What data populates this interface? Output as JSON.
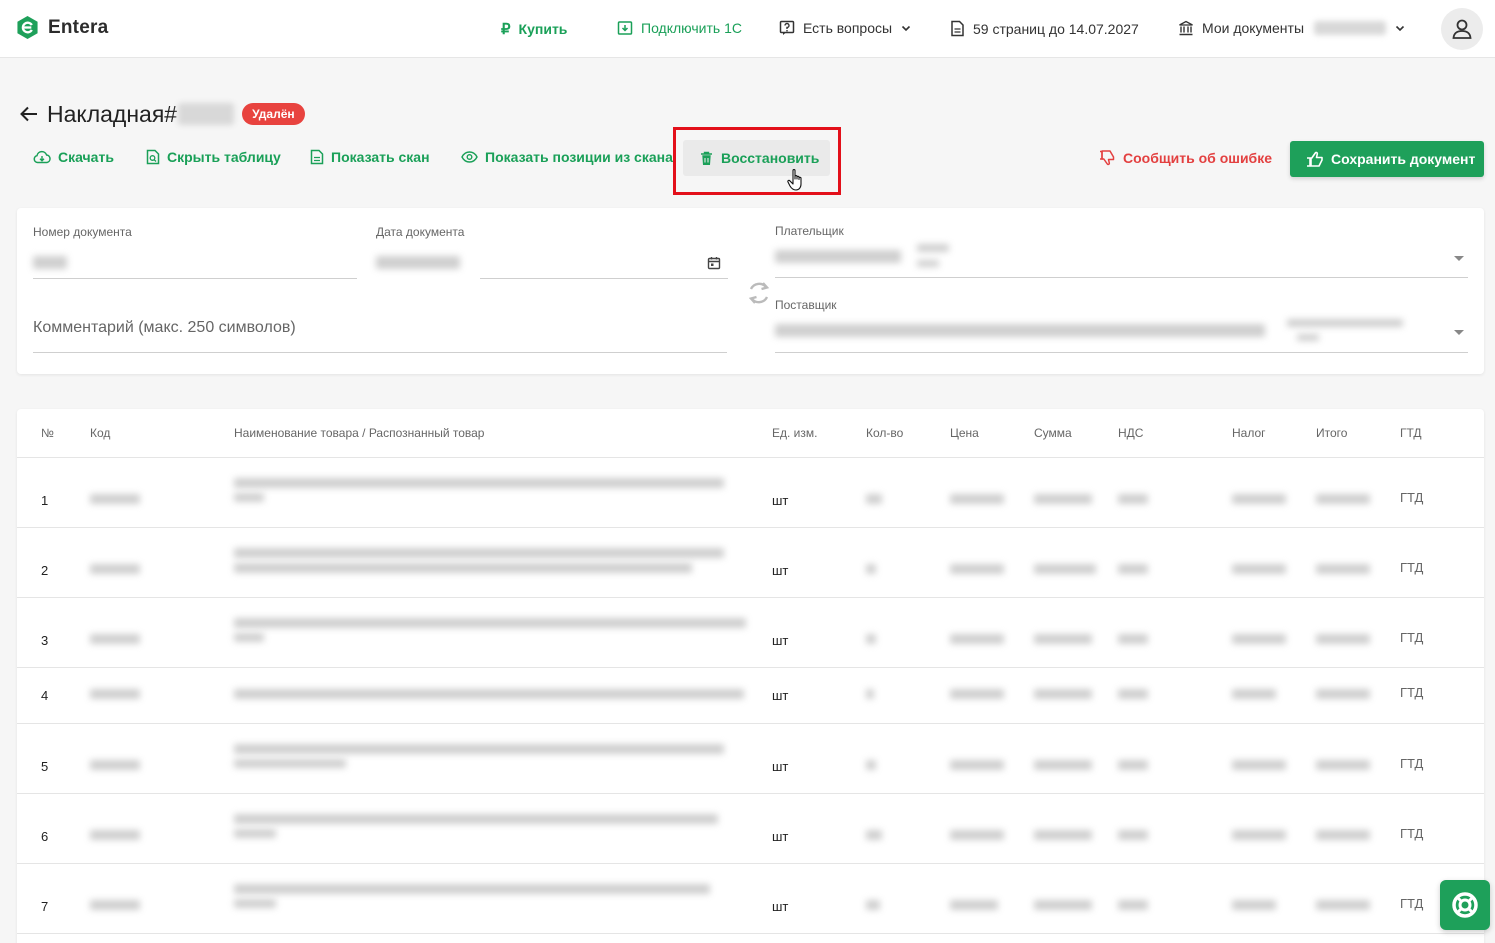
{
  "header": {
    "logo_text": "Entera",
    "buy_label": "Купить",
    "connect_label": "Подключить 1С",
    "questions_label": "Есть вопросы",
    "pages_label": "59 страниц до 14.07.2027",
    "documents_label": "Мои документы"
  },
  "title": {
    "text": "Накладная#",
    "status_badge": "Удалён"
  },
  "actions": {
    "download": "Скачать",
    "hide_table": "Скрыть таблицу",
    "show_scan": "Показать скан",
    "show_positions": "Показать позиции из скана",
    "restore": "Восстановить",
    "report_error": "Сообщить об ошибке",
    "save": "Сохранить документ"
  },
  "form": {
    "doc_number_label": "Номер документа",
    "doc_date_label": "Дата документа",
    "payer_label": "Плательщик",
    "supplier_label": "Поставщик",
    "comment_placeholder": "Комментарий (макс. 250 символов)"
  },
  "table": {
    "columns": [
      "№",
      "Код",
      "Наименование товара / Распознанный товар",
      "Ед. изм.",
      "Кол-во",
      "Цена",
      "Сумма",
      "НДС",
      "Налог",
      "Итого",
      "ГТД"
    ],
    "rows": [
      {
        "num": "1",
        "unit": "шт",
        "gtd": "ГТД"
      },
      {
        "num": "2",
        "unit": "шт",
        "gtd": "ГТД"
      },
      {
        "num": "3",
        "unit": "шт",
        "gtd": "ГТД"
      },
      {
        "num": "4",
        "unit": "шт",
        "gtd": "ГТД"
      },
      {
        "num": "5",
        "unit": "шт",
        "gtd": "ГТД"
      },
      {
        "num": "6",
        "unit": "шт",
        "gtd": "ГТД"
      },
      {
        "num": "7",
        "unit": "шт",
        "gtd": "ГТД"
      }
    ]
  },
  "colors": {
    "brand_green": "#1ea05a",
    "danger_red": "#e8433f",
    "highlight_red": "#e3101a"
  }
}
